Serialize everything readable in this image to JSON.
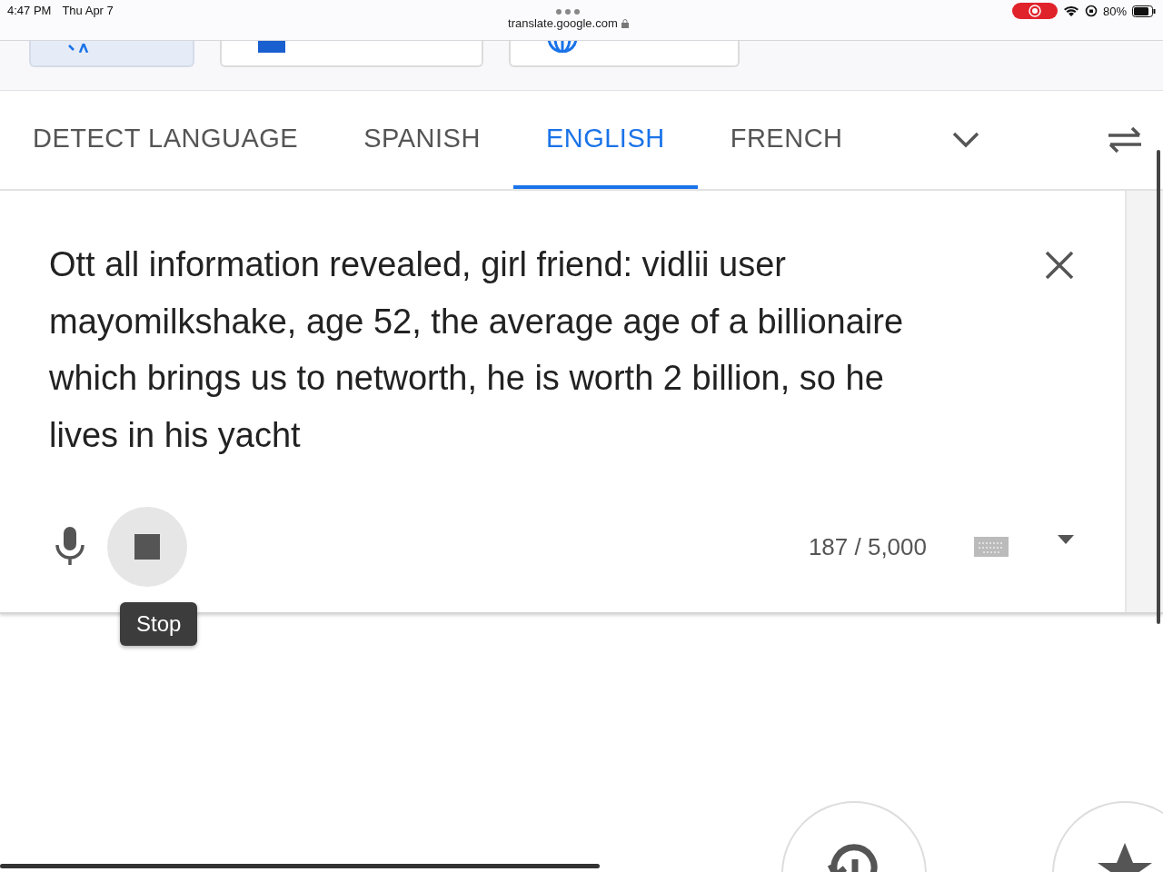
{
  "status_bar": {
    "time": "4:47 PM",
    "date": "Thu Apr 7",
    "url": "translate.google.com",
    "battery": "80%"
  },
  "language_tabs": [
    {
      "label": "DETECT LANGUAGE",
      "selected": false
    },
    {
      "label": "SPANISH",
      "selected": false
    },
    {
      "label": "ENGLISH",
      "selected": true
    },
    {
      "label": "FRENCH",
      "selected": false
    }
  ],
  "source": {
    "text": "Ott all information revealed, girl friend: vidlii user mayomilkshake, age 52, the average age of a billionaire which brings us to networth, he is worth 2 billion, so he lives in his yacht",
    "count": "187 / 5,000",
    "stop_tooltip": "Stop"
  }
}
